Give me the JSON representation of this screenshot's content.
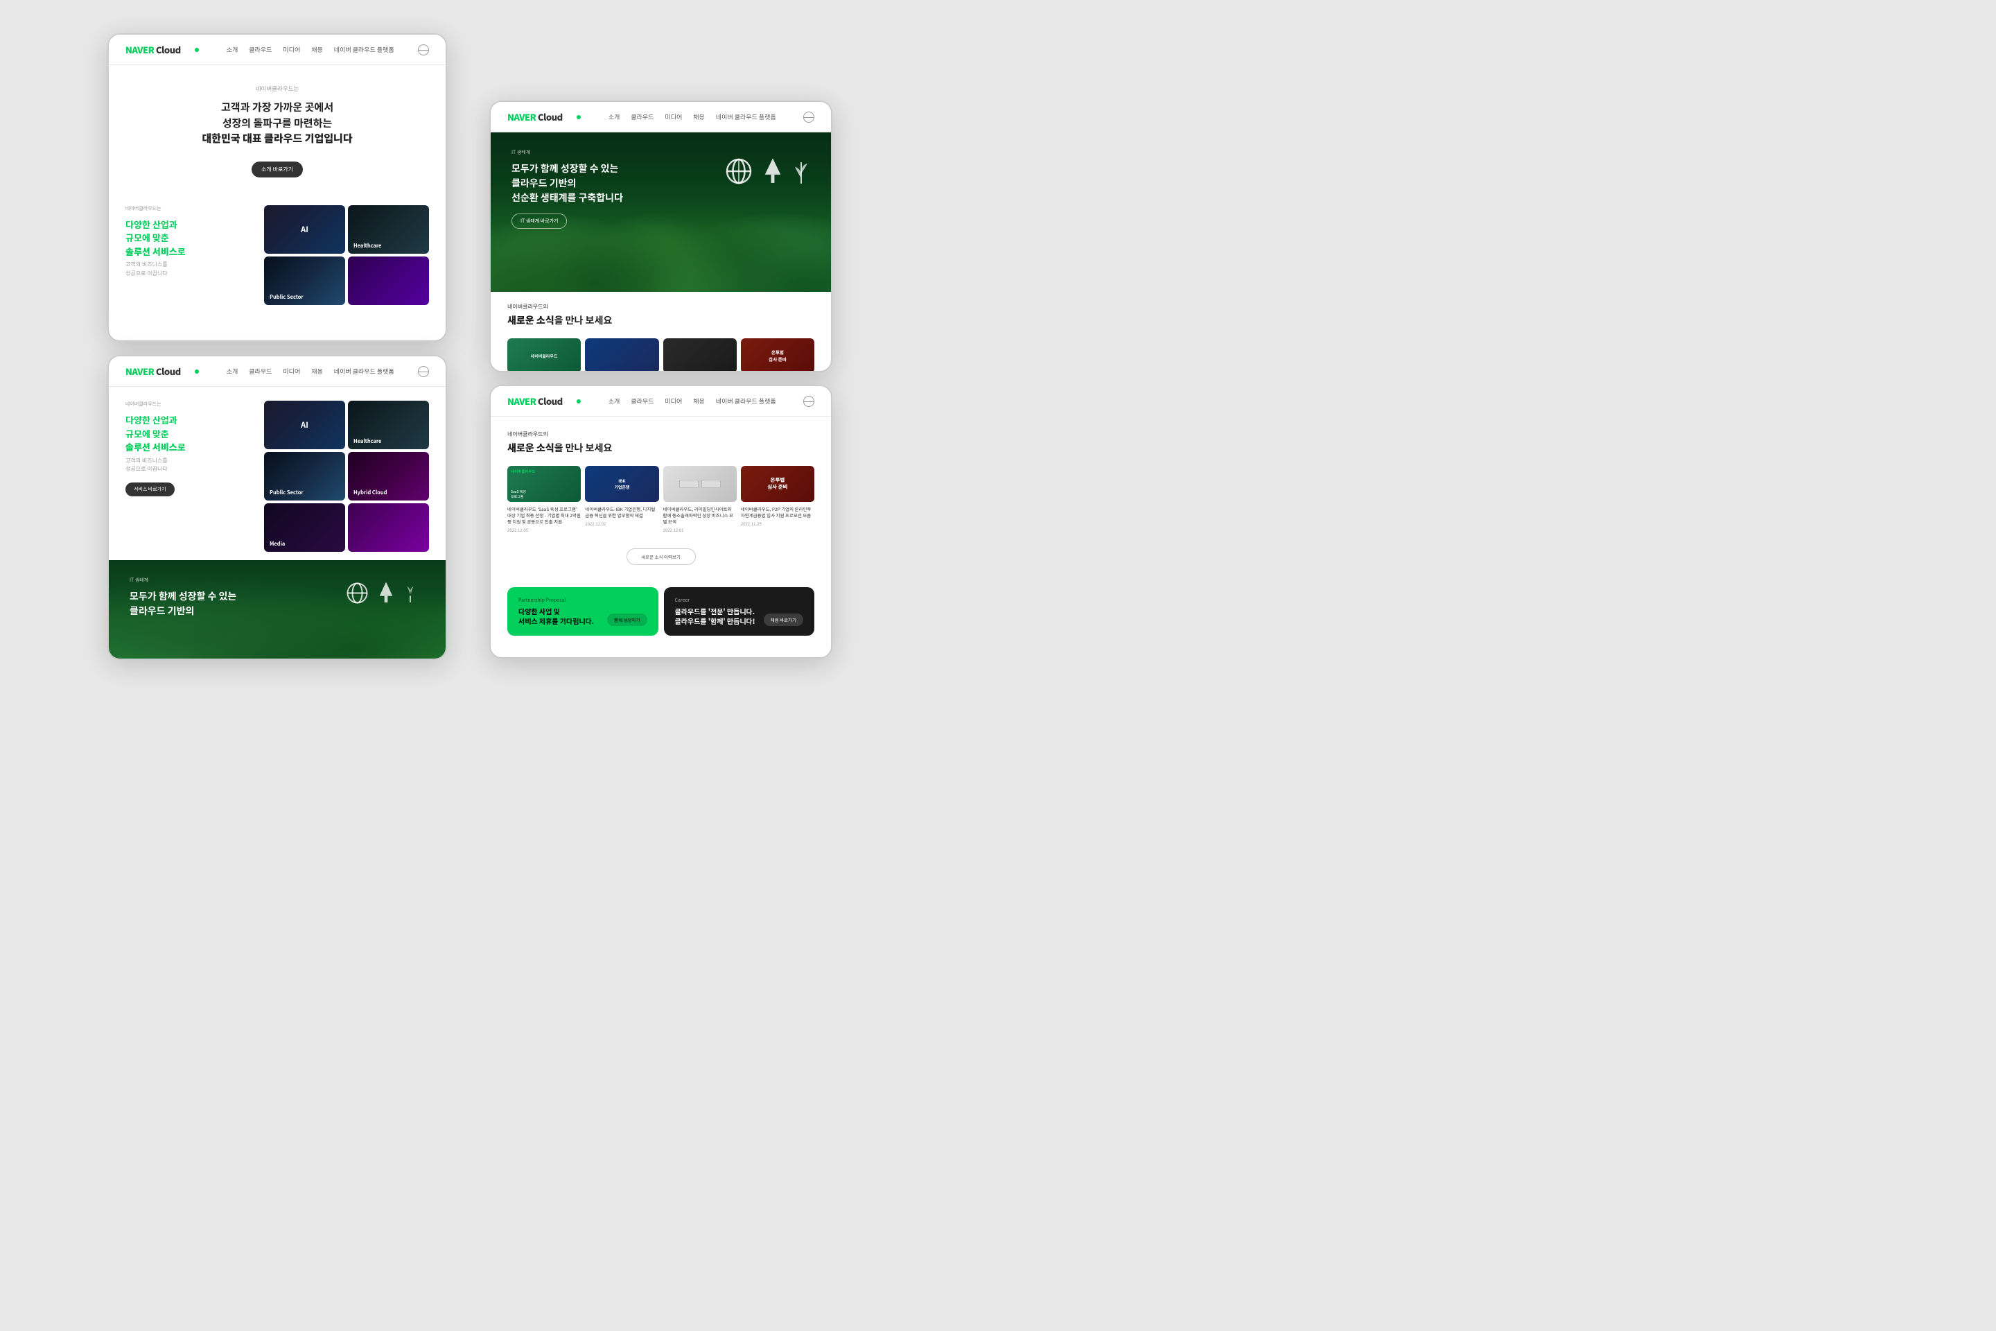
{
  "brand": {
    "name": "NAVER Cloud",
    "logo_green": "NAVER",
    "logo_dark": " Cloud"
  },
  "nav": {
    "links": [
      "소개",
      "클라우드",
      "미디어",
      "채용",
      "채용",
      "네이버 클라우드 플랫폼"
    ],
    "active": "소개",
    "globe_label": "language-selector"
  },
  "window1": {
    "hero": {
      "sub": "네이버클라우드는",
      "line1": "고객과 가장 가까운 곳에서",
      "line2": "성장의 돌파구를 마련하는",
      "line3": "대한민국 대표 클라우드 기업입니다",
      "btn": "소개 바로가기"
    },
    "industry": {
      "sub": "네이버클라우드는",
      "title1": "다양한 산업과",
      "title2": "규모에 맞춘",
      "title3_main": "솔루션 서비스",
      "title3_suffix": "로",
      "desc1": "고객의 비즈니스를",
      "desc2": "성공으로 이끕니다",
      "cards": [
        {
          "label": "AI",
          "type": "card-ai"
        },
        {
          "label": "Healthcare",
          "type": "card-healthcare"
        },
        {
          "label": "Public Sector",
          "type": "card-public"
        },
        {
          "label": "",
          "type": "card-purple"
        }
      ]
    }
  },
  "window2": {
    "industry": {
      "sub": "네이버클라우드는",
      "title1": "다양한 산업과",
      "title2": "규모에 맞춘",
      "title3_main": "솔루션 서비스",
      "title3_suffix": "로",
      "desc1": "고객의 비즈니스를",
      "desc2": "성공으로 이끕니다",
      "btn": "서비스 바로가기",
      "cards": [
        {
          "label": "AI",
          "type": "card-ai"
        },
        {
          "label": "Healthcare",
          "type": "card-healthcare"
        },
        {
          "label": "Public Sector",
          "type": "card-public"
        },
        {
          "label": "Hybrid Cloud",
          "type": "card-hybrid"
        },
        {
          "label": "Media",
          "type": "card-media"
        },
        {
          "label": "",
          "type": "card-purple"
        }
      ]
    },
    "eco": {
      "tag": "IT 생태계",
      "title1": "모두가 함께 성장할 수 있는",
      "title2_partial": "클라우드 기반의"
    }
  },
  "window3": {
    "eco": {
      "tag": "IT 생태계",
      "title1": "모두가 함께 성장할 수 있는",
      "title2": "클라우드 기반의",
      "title3": "선순환 생태계를 구축합니다",
      "btn": "IT 생태계 바로가기"
    },
    "news": {
      "sub": "네이버클라우드의",
      "title": "새로운 소식",
      "title_suffix": "을 만나 보세요",
      "cards": [
        {
          "img_class": "nc1",
          "img_text": "네이버클라우드"
        },
        {
          "img_class": "nc2",
          "img_text": "IBK 기업은행"
        },
        {
          "img_class": "nc3",
          "img_text": ""
        },
        {
          "img_class": "nc4",
          "img_text": "온투법 심사 준비"
        }
      ]
    }
  },
  "window4": {
    "news": {
      "sub": "네이버클라우드의",
      "title": "새로운 소식",
      "title_suffix": "을 만나 보세요",
      "cards": [
        {
          "img_class": "nc1",
          "img_text": "네이버클라우드",
          "label": "네이버클라우드 'SaaS 육성 프로그램' 대상 기업 최종 선정 - 기업별 최대 2억원 등 지원 및 공동으로 진출 지원",
          "date": "2022.12.05"
        },
        {
          "img_class": "nc2",
          "img_text": "IBK 기업은행",
          "label": "네이버클라우드-IBK 기업은행, 디지털 금융 혁신을 위한 업무협약 체결",
          "date": "2022.12.02"
        },
        {
          "img_class": "nc3",
          "img_text": "",
          "label": "네이버클라우드, 라이빌딩인사이트와 함께 중소솔래파력인 성장 비즈니스 모델 모색",
          "date": "2022.12.01"
        },
        {
          "img_class": "nc4",
          "img_text": "온투법 심사 준비",
          "label": "네이버클라우드, P2P 기업의 온라인투자연계금융업 입사 지원 프로모션 모음",
          "date": "2022.11.29"
        }
      ],
      "more_btn": "새로운 소식 이력보기"
    },
    "cta": {
      "left": {
        "type": "Partnership Proposal",
        "sub": "Partnership Proposal",
        "title1": "다양한 사업 및",
        "title2": "서비스 제휴를 기다립니다.",
        "btn": "함께 성장하기"
      },
      "right": {
        "type": "Career",
        "sub": "Career",
        "title1": "클라우드를 '전문' 만듭니다.",
        "title2": "클라우드를 '함께' 만듭니다!",
        "btn": "채용 바로가기"
      }
    }
  },
  "colors": {
    "green": "#03cf5d",
    "dark": "#1a1a1a",
    "text_main": "#222222",
    "text_sub": "#999999"
  }
}
